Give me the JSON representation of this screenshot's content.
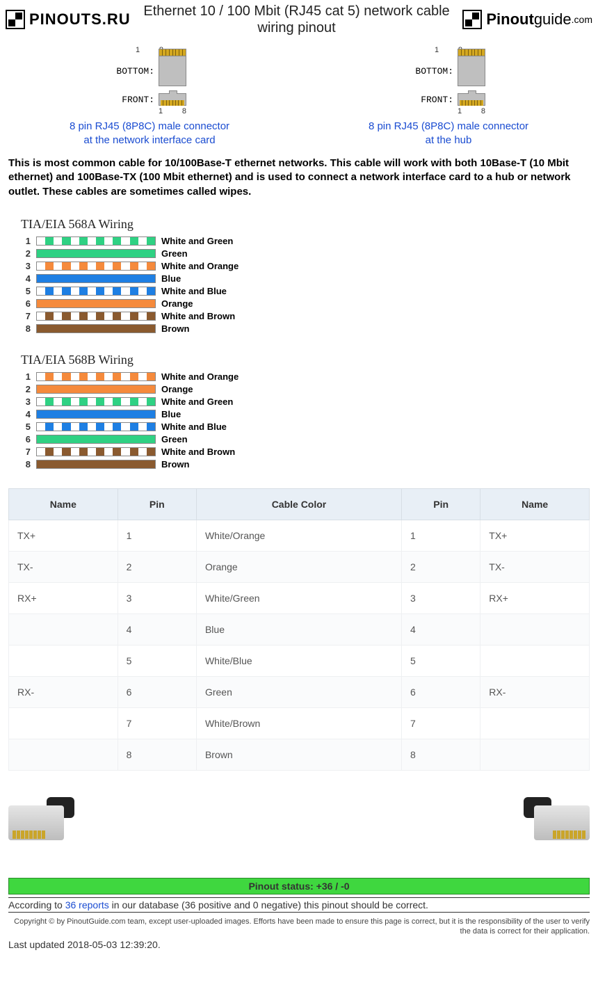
{
  "header": {
    "logo_left": "PINOUTS.RU",
    "title": "Ethernet 10 / 100 Mbit (RJ45 cat 5) network cable wiring pinout",
    "logo_right_bold": "Pinout",
    "logo_right_light": "guide",
    "logo_right_com": ".com"
  },
  "connectors": {
    "bottom_label": "BOTTOM:",
    "front_label": "FRONT:",
    "pin1": "1",
    "pin8": "8",
    "left_link_l1": "8 pin RJ45 (8P8C) male connector",
    "left_link_l2": "at the network interface card",
    "right_link_l1": "8 pin RJ45 (8P8C) male connector",
    "right_link_l2": "at the hub"
  },
  "intro": "This is most common cable for 10/100Base-T ethernet networks. This cable will work with both 10Base-T (10 Mbit ethernet) and 100Base-TX (100 Mbit ethernet) and is used to connect a network interface card to a hub or network outlet. These cables are sometimes called wipes.",
  "wiring_a": {
    "title": "TIA/EIA 568A Wiring",
    "rows": [
      {
        "n": "1",
        "label": "White and Green",
        "striped": true,
        "color": "green"
      },
      {
        "n": "2",
        "label": "Green",
        "striped": false,
        "color": "green"
      },
      {
        "n": "3",
        "label": "White and Orange",
        "striped": true,
        "color": "orange"
      },
      {
        "n": "4",
        "label": "Blue",
        "striped": false,
        "color": "blue"
      },
      {
        "n": "5",
        "label": "White and Blue",
        "striped": true,
        "color": "blue"
      },
      {
        "n": "6",
        "label": "Orange",
        "striped": false,
        "color": "orange"
      },
      {
        "n": "7",
        "label": "White and Brown",
        "striped": true,
        "color": "brown"
      },
      {
        "n": "8",
        "label": "Brown",
        "striped": false,
        "color": "brown"
      }
    ]
  },
  "wiring_b": {
    "title": "TIA/EIA 568B Wiring",
    "rows": [
      {
        "n": "1",
        "label": "White and Orange",
        "striped": true,
        "color": "orange"
      },
      {
        "n": "2",
        "label": "Orange",
        "striped": false,
        "color": "orange"
      },
      {
        "n": "3",
        "label": "White and Green",
        "striped": true,
        "color": "green"
      },
      {
        "n": "4",
        "label": "Blue",
        "striped": false,
        "color": "blue"
      },
      {
        "n": "5",
        "label": "White and Blue",
        "striped": true,
        "color": "blue"
      },
      {
        "n": "6",
        "label": "Green",
        "striped": false,
        "color": "green"
      },
      {
        "n": "7",
        "label": "White and Brown",
        "striped": true,
        "color": "brown"
      },
      {
        "n": "8",
        "label": "Brown",
        "striped": false,
        "color": "brown"
      }
    ]
  },
  "table": {
    "headers": [
      "Name",
      "Pin",
      "Cable Color",
      "Pin",
      "Name"
    ],
    "rows": [
      [
        "TX+",
        "1",
        "White/Orange",
        "1",
        "TX+"
      ],
      [
        "TX-",
        "2",
        "Orange",
        "2",
        "TX-"
      ],
      [
        "RX+",
        "3",
        "White/Green",
        "3",
        "RX+"
      ],
      [
        "",
        "4",
        "Blue",
        "4",
        ""
      ],
      [
        "",
        "5",
        "White/Blue",
        "5",
        ""
      ],
      [
        "RX-",
        "6",
        "Green",
        "6",
        "RX-"
      ],
      [
        "",
        "7",
        "White/Brown",
        "7",
        ""
      ],
      [
        "",
        "8",
        "Brown",
        "8",
        ""
      ]
    ]
  },
  "status": {
    "bar": "Pinout status: +36 / -0",
    "note_pre": "According to ",
    "note_link": "36 reports",
    "note_post": " in our database (36 positive and 0 negative) this pinout should be correct."
  },
  "copyright": "Copyright © by PinoutGuide.com team, except user-uploaded images. Efforts have been made to ensure this page is correct, but it is the responsibility of the user to verify the data is correct for their application.",
  "last_updated": "Last updated 2018-05-03 12:39:20."
}
